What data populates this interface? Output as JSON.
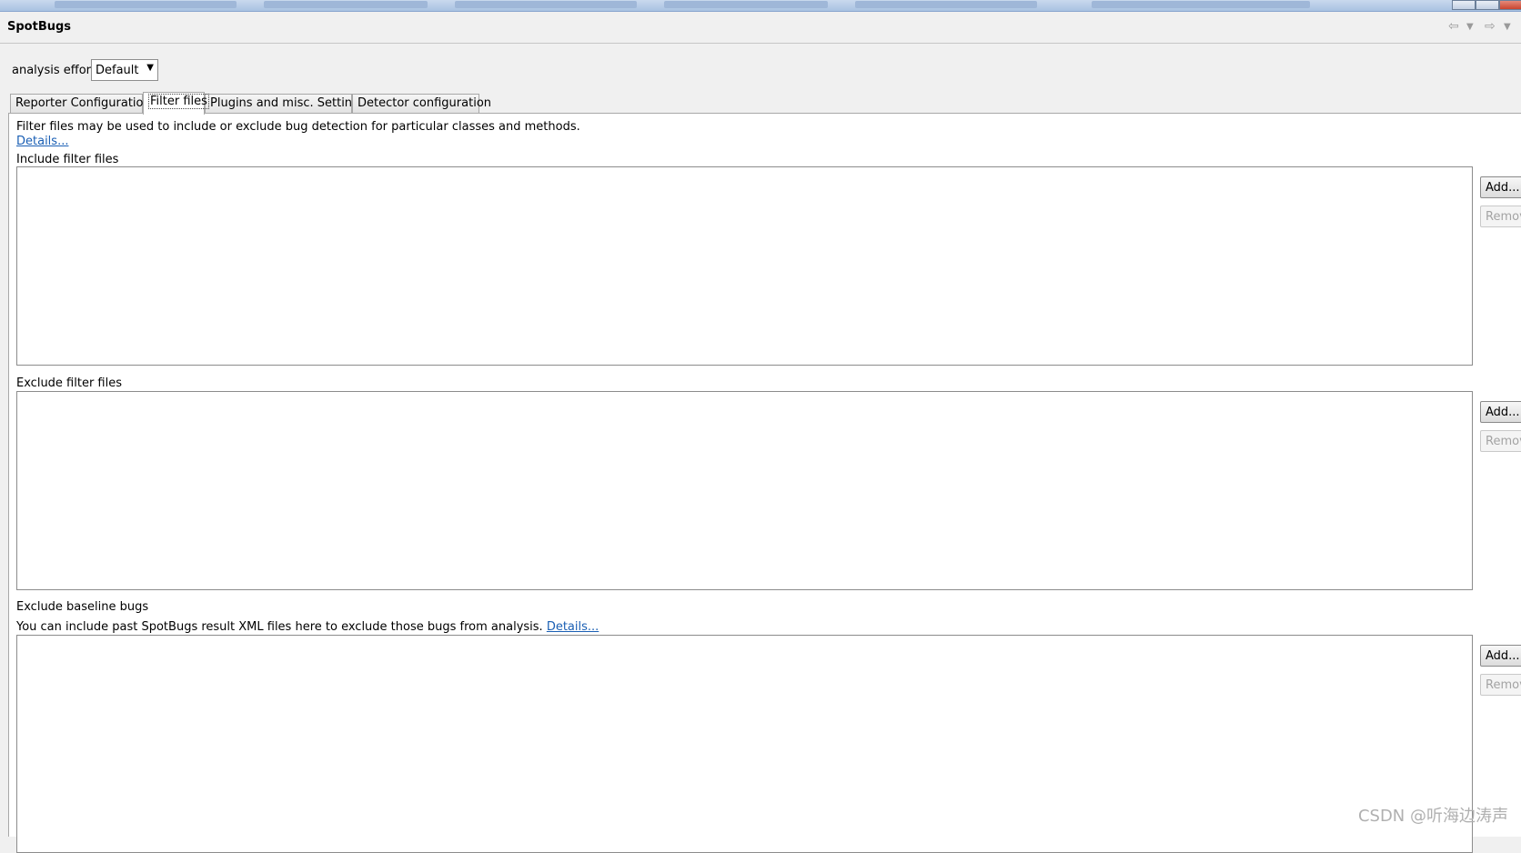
{
  "app": {
    "title": "SpotBugs"
  },
  "effort": {
    "label": "analysis effort",
    "value": "Default"
  },
  "tabs": [
    {
      "label": "Reporter Configuration",
      "active": false
    },
    {
      "label": "Filter files",
      "active": true
    },
    {
      "label": "Plugins and misc. Settings",
      "active": false
    },
    {
      "label": "Detector configuration",
      "active": false
    }
  ],
  "filters": {
    "intro": "Filter files may be used to include or exclude bug detection for particular classes and methods.",
    "details_link": "Details...",
    "include": {
      "label": "Include filter files",
      "add": "Add...",
      "remove": "Remove"
    },
    "exclude": {
      "label": "Exclude filter files",
      "add": "Add...",
      "remove": "Remove"
    },
    "baseline": {
      "label": "Exclude baseline bugs",
      "desc": "You can include past SpotBugs result XML files here to exclude those bugs from analysis.",
      "details_link": "Details...",
      "add": "Add...",
      "remove": "Remove"
    }
  },
  "watermark": "CSDN @听海边涛声"
}
